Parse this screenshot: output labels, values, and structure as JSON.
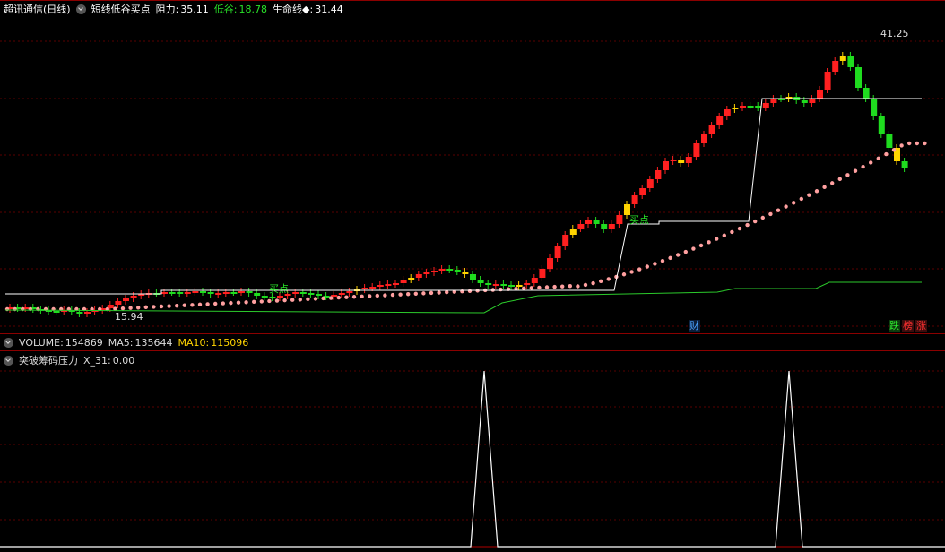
{
  "main": {
    "title": "超讯通信(日线)",
    "indicator_name": "短线低谷买点",
    "resistance_label": "阻力:",
    "resistance_value": "35.11",
    "valley_label": "低谷:",
    "valley_value": "18.78",
    "lifeline_label": "生命线◆:",
    "lifeline_value": "31.44",
    "high_price": "41.25",
    "low_price": "15.94",
    "buy_label": "买点",
    "tags": {
      "cai": "财",
      "die": "跌",
      "bang": "榜",
      "zhang": "涨"
    }
  },
  "volume": {
    "label": "VOLUME:",
    "value": "154869",
    "ma5_label": "MA5:",
    "ma5_value": "135644",
    "ma10_label": "MA10:",
    "ma10_value": "115096"
  },
  "indicator": {
    "name": "突破筹码压力",
    "x_label": "X_31:",
    "x_value": "0.00"
  },
  "colors": {
    "up": "#ff2020",
    "down": "#1fdc1f",
    "yellow": "#ffd400",
    "valley_green": "#28e028",
    "lifeline": "#ffa0a0",
    "grid": "#5a0000",
    "resistance_line": "#ffffff",
    "support_line": "#2bc92b",
    "cai_tag": "#4aa3ff",
    "die_tag": "#2ee82e",
    "bang_tag": "#ff3030",
    "zhang_tag": "#ff3030",
    "ma10": "#ffd400"
  }
}
